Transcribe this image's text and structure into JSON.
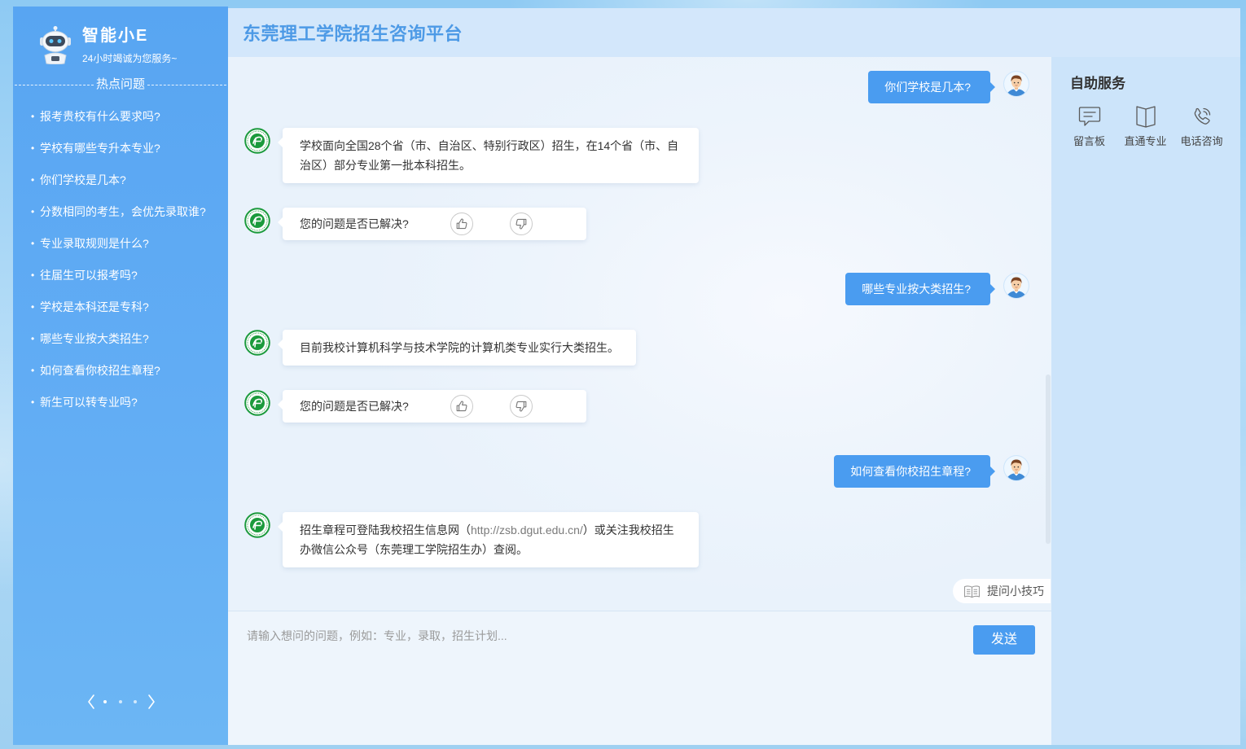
{
  "theme": {
    "accent": "#4a9cf0",
    "title": "#4d9ae6",
    "sidebar_top": "#58a5f2",
    "sidebar_bottom": "#6cb6f4",
    "seal": "#1b9a3c"
  },
  "sidebar": {
    "icon": "robot-icon",
    "title": "智能小E",
    "subtitle": "24小时竭诚为您服务~",
    "hot_title": "热点问题",
    "hot_questions": [
      "报考贵校有什么要求吗?",
      "学校有哪些专升本专业?",
      "你们学校是几本?",
      "分数相同的考生，会优先录取谁?",
      "专业录取规则是什么?",
      "往届生可以报考吗?",
      "学校是本科还是专科?",
      "哪些专业按大类招生?",
      "如何查看你校招生章程?",
      "新生可以转专业吗?"
    ],
    "pagination": {
      "page_count": 3,
      "current_page": 1
    }
  },
  "header": {
    "title": "东莞理工学院招生咨询平台"
  },
  "chat": {
    "messages": [
      {
        "user": "你们学校是几本?"
      },
      {
        "bot": "学校面向全国28个省（市、自治区、特别行政区）招生，在14个省（市、自治区）部分专业第一批本科招生。"
      },
      {
        "feedback": "您的问题是否已解决?"
      },
      {
        "user": "哪些专业按大类招生?"
      },
      {
        "bot": "目前我校计算机科学与技术学院的计算机类专业实行大类招生。"
      },
      {
        "feedback": "您的问题是否已解决?"
      },
      {
        "user": "如何查看你校招生章程?"
      },
      {
        "bot": {
          "text_before": "招生章程可登陆我校招生信息网（",
          "link": "http://zsb.dgut.edu.cn/",
          "text_after": "）或关注我校招生办微信公众号（东莞理工学院招生办）查阅。"
        }
      }
    ],
    "tips_label": "提问小技巧",
    "tips_icon": "book-open-icon"
  },
  "input": {
    "placeholder": "请输入想问的问题，例如：专业，录取，招生计划...",
    "send_label": "发送"
  },
  "self_service": {
    "title": "自助服务",
    "items": [
      {
        "label": "留言板",
        "icon": "message-board-icon"
      },
      {
        "label": "直通专业",
        "icon": "book-icon"
      },
      {
        "label": "电话咨询",
        "icon": "phone-icon"
      }
    ]
  }
}
